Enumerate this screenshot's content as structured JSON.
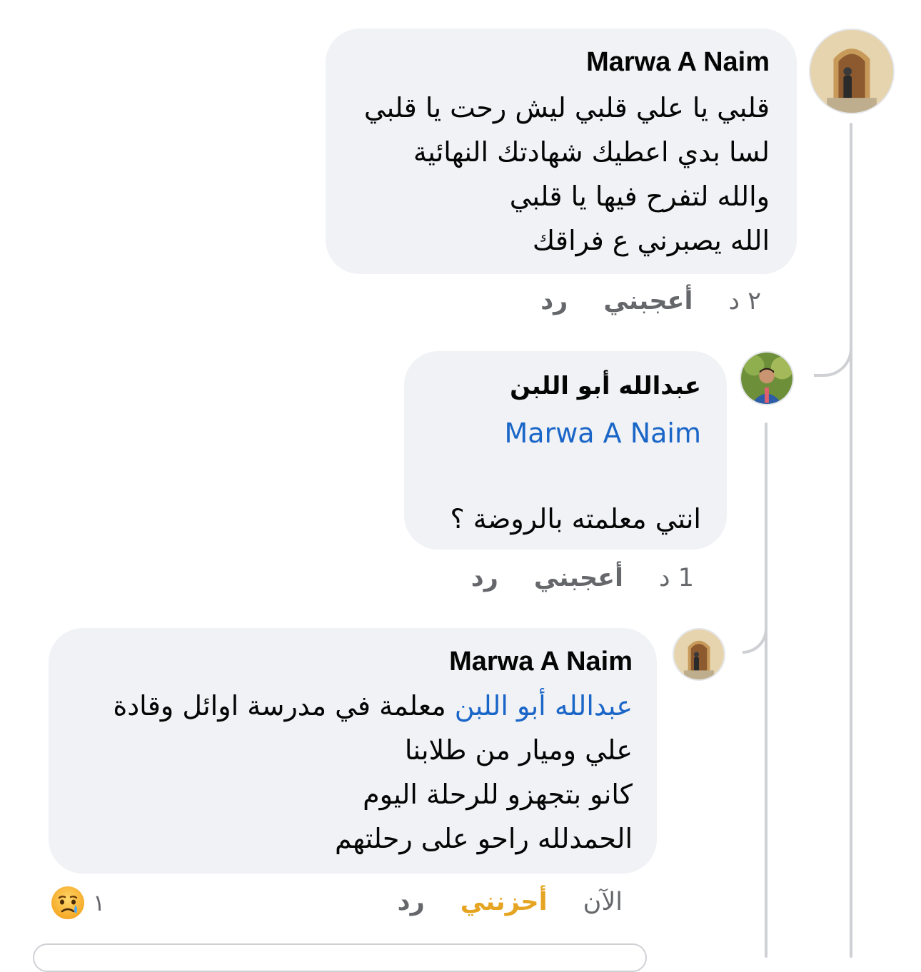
{
  "comments": [
    {
      "author": "Marwa A Naim",
      "lines": [
        "قلبي يا علي قلبي ليش رحت يا قلبي",
        "لسا بدي اعطيك شهادتك النهائية",
        "والله لتفرح فيها يا قلبي",
        "الله يصبرني ع فراقك"
      ],
      "time": "٢ د",
      "like_label": "أعجبني",
      "reply_label": "رد"
    },
    {
      "author": "عبدالله أبو اللبن",
      "mention": "Marwa A Naim",
      "text": "انتي معلمته بالروضة ؟",
      "time": "1 د",
      "like_label": "أعجبني",
      "reply_label": "رد"
    },
    {
      "author": "Marwa A Naim",
      "mention": "عبدالله أبو اللبن",
      "first_line_rest": " معلمة في مدرسة اوائل وقادة",
      "lines": [
        "علي وميار من طلابنا",
        "كانو بتجهزو للرحلة اليوم",
        "الحمدلله راحو على رحلتهم"
      ],
      "time": "الآن",
      "reaction_label": "أحزنني",
      "reply_label": "رد",
      "reaction_count": "١",
      "reaction_icon": "sad-crying-emoji-icon"
    }
  ],
  "colors": {
    "bubble": "#f0f2f5",
    "mention": "#1a66c8",
    "meta": "#65676b",
    "sad_reaction": "#e5a422",
    "thread_line": "#ced0d4"
  }
}
